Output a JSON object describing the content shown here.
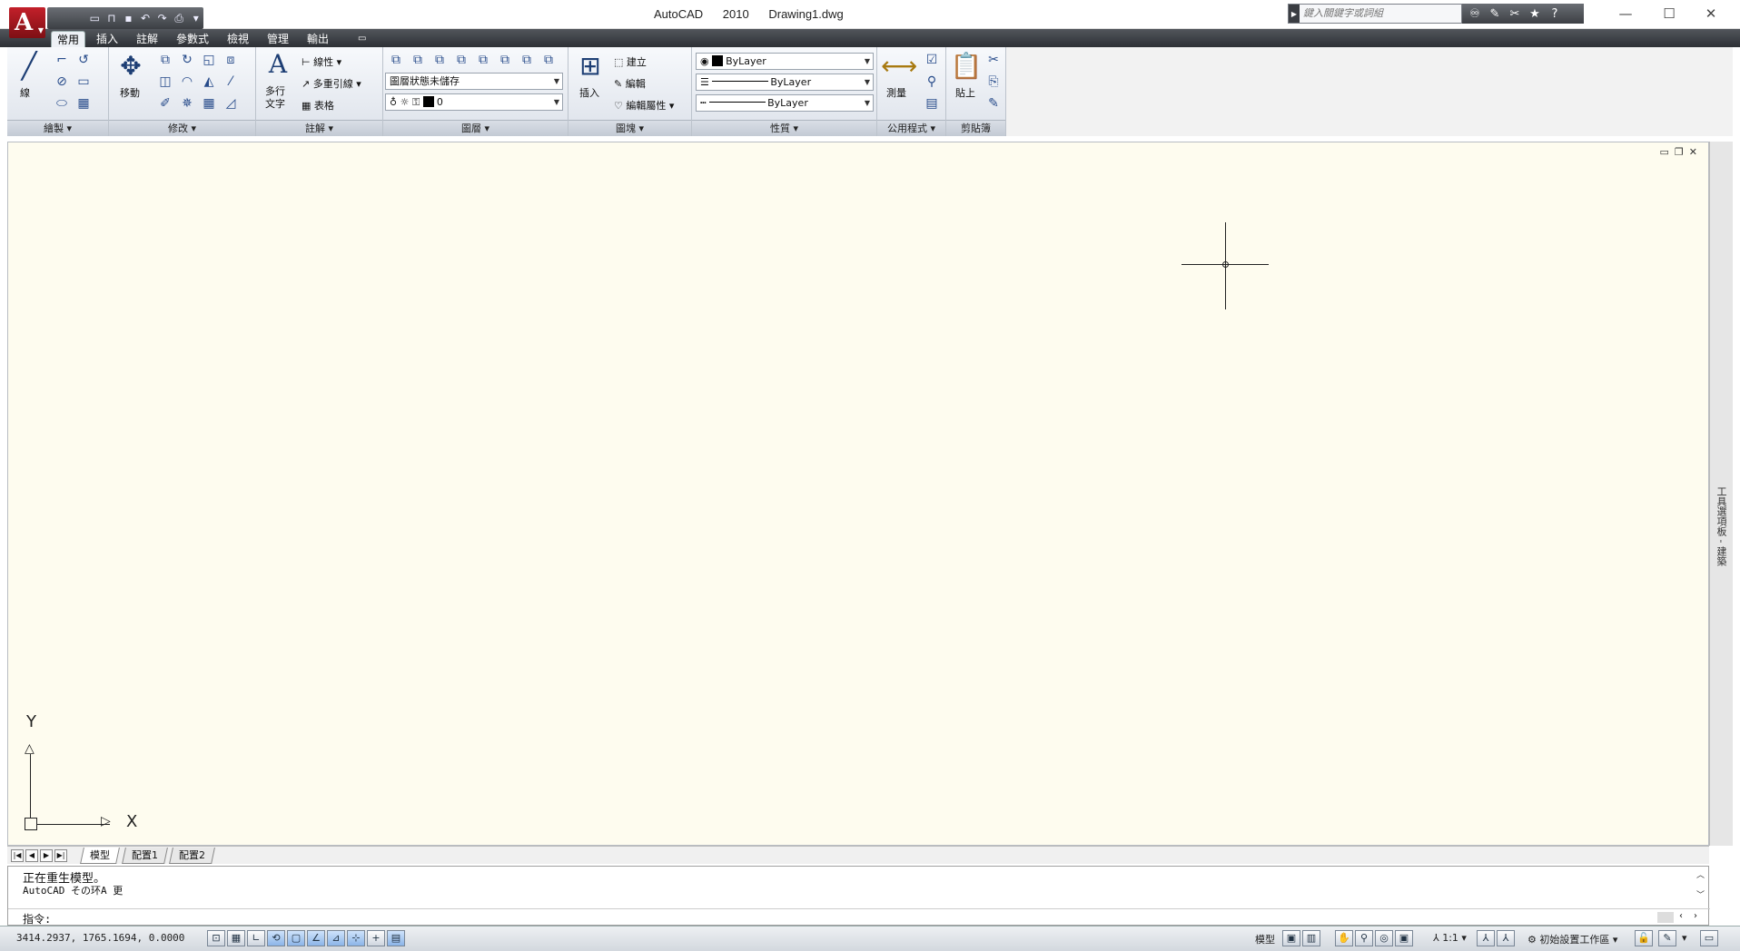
{
  "titlebar": {
    "app_name": "AutoCAD 2010",
    "document_name": "Drawing1.dwg",
    "search_placeholder": "鍵入關鍵字或詞組",
    "window_controls": [
      "minimize-icon",
      "maximize-icon",
      "close-icon"
    ]
  },
  "quick_access": [
    "new-icon",
    "open-icon",
    "save-icon",
    "undo-icon",
    "redo-icon",
    "plot-icon"
  ],
  "ribbon_tabs": [
    "常用",
    "插入",
    "註解",
    "參數式",
    "檢視",
    "管理",
    "輸出"
  ],
  "ribbon": {
    "draw": {
      "title": "繪製",
      "line_label": "線"
    },
    "modify": {
      "title": "修改",
      "move_label": "移動"
    },
    "annotation": {
      "title": "註解",
      "mtext_label_1": "多行",
      "mtext_label_2": "文字",
      "linear_label": "線性",
      "mleader_label": "多重引線",
      "table_label": "表格"
    },
    "layers": {
      "title": "圖層",
      "layer_state": "圖層狀態未儲存",
      "current_layer": "0"
    },
    "block": {
      "title": "圖塊",
      "insert_label": "插入",
      "create_label": "建立",
      "edit_label": "編輯",
      "edit_attributes_label": "編輯屬性"
    },
    "properties": {
      "title": "性質",
      "color": "ByLayer",
      "lineweight": "ByLayer",
      "linetype": "ByLayer"
    },
    "utilities": {
      "title": "公用程式",
      "measure_label": "測量"
    },
    "clipboard": {
      "title": "剪貼簿",
      "paste_label": "貼上"
    }
  },
  "drawing": {
    "ucs_x_label": "X",
    "ucs_y_label": "Y",
    "tool_palette_label": "工具選項板 - 建築"
  },
  "layout_tabs": [
    "模型",
    "配置1",
    "配置2"
  ],
  "command": {
    "history_line_1": "正在重生模型。",
    "history_line_2": "AutoCAD       その环A   更",
    "prompt": "指令:"
  },
  "statusbar": {
    "coordinates": "3414.2937, 1765.1694, 0.0000",
    "model_label": "模型",
    "annotation_scale": "1:1",
    "workspace": "初始設置工作區"
  },
  "colors": {
    "drawing_background": "#fefcef",
    "ribbon_dark": "#2d3035",
    "logo_red": "#c3202a"
  }
}
